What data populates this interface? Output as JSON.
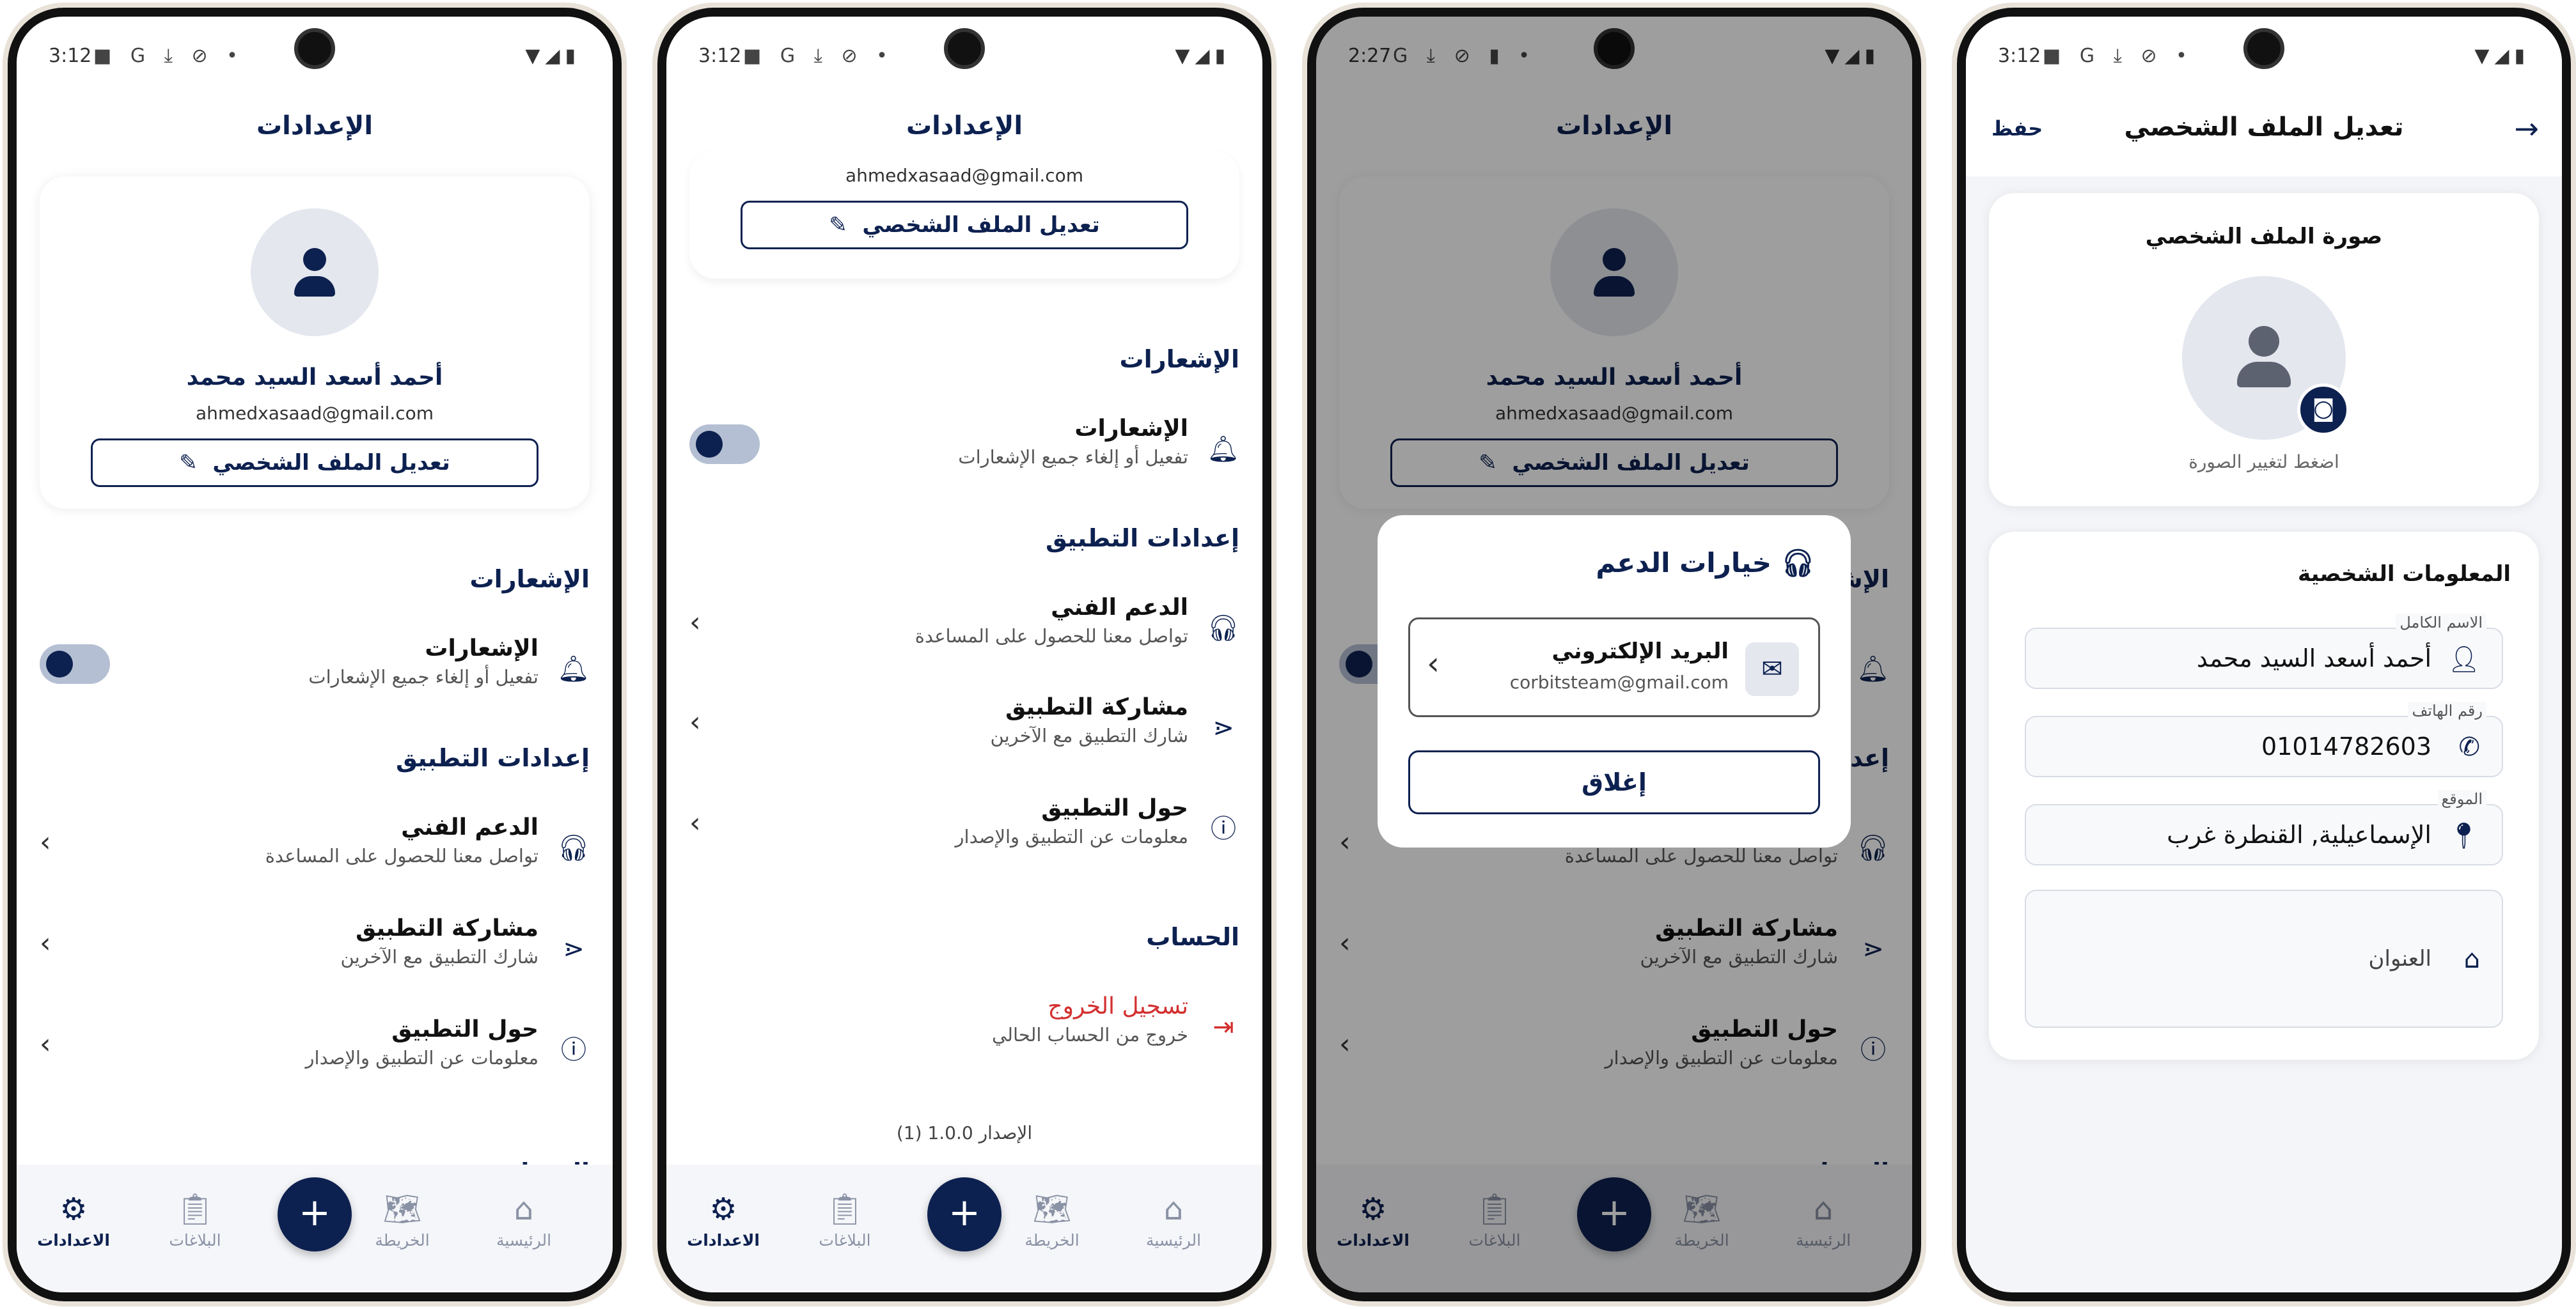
{
  "colors": {
    "primary": "#0d2150",
    "danger": "#d32f2f",
    "muted": "#8a92a5"
  },
  "screen1": {
    "status_time": "3:12",
    "title": "الإعدادات",
    "profile": {
      "name": "أحمد أسعد السيد محمد",
      "email": "ahmedxasaad@gmail.com",
      "edit_label": "تعديل الملف الشخصي"
    },
    "notifications_section": "الإشعارات",
    "notifications": {
      "title": "الإشعارات",
      "subtitle": "تفعيل أو إلغاء جميع الإشعارات",
      "enabled": true
    },
    "app_settings_section": "إعدادات التطبيق",
    "items": [
      {
        "title": "الدعم الفني",
        "subtitle": "تواصل معنا للحصول على المساعدة",
        "icon": "headset-icon"
      },
      {
        "title": "مشاركة التطبيق",
        "subtitle": "شارك التطبيق مع الآخرين",
        "icon": "share-icon"
      },
      {
        "title": "حول التطبيق",
        "subtitle": "معلومات عن التطبيق والإصدار",
        "icon": "info-icon"
      }
    ],
    "account_section_partial": "الحساب"
  },
  "screen2": {
    "status_time": "3:12",
    "title": "الإعدادات",
    "email": "ahmedxasaad@gmail.com",
    "edit_label": "تعديل الملف الشخصي",
    "notifications_section": "الإشعارات",
    "notifications": {
      "title": "الإشعارات",
      "subtitle": "تفعيل أو إلغاء جميع الإشعارات"
    },
    "app_settings_section": "إعدادات التطبيق",
    "items": [
      {
        "title": "الدعم الفني",
        "subtitle": "تواصل معنا للحصول على المساعدة"
      },
      {
        "title": "مشاركة التطبيق",
        "subtitle": "شارك التطبيق مع الآخرين"
      },
      {
        "title": "حول التطبيق",
        "subtitle": "معلومات عن التطبيق والإصدار"
      }
    ],
    "account_section": "الحساب",
    "logout": {
      "title": "تسجيل الخروج",
      "subtitle": "خروج من الحساب الحالي"
    },
    "version": "الإصدار 1.0.0 (1)"
  },
  "screen3": {
    "status_time": "2:27",
    "dialog": {
      "title": "خيارات الدعم",
      "option_title": "البريد الإلكتروني",
      "option_email": "corbitsteam@gmail.com",
      "close_label": "إغلاق"
    }
  },
  "screen4": {
    "status_time": "3:12",
    "title": "تعديل الملف الشخصي",
    "save_label": "حفظ",
    "photo_card_title": "صورة الملف الشخصي",
    "photo_hint": "اضغط لتغيير الصورة",
    "personal_info_title": "المعلومات الشخصية",
    "fields": [
      {
        "label": "الاسم الكامل",
        "value": "أحمد أسعد السيد محمد",
        "icon": "person-icon"
      },
      {
        "label": "رقم الهاتف",
        "value": "01014782603",
        "icon": "phone-icon"
      },
      {
        "label": "الموقع",
        "value": "الإسماعيلية, القنطرة غرب",
        "icon": "location-icon"
      }
    ],
    "address_placeholder": "العنوان"
  },
  "nav": {
    "home": "الرئيسية",
    "map": "الخريطة",
    "reports": "البلاغات",
    "settings": "الاعدادات",
    "add": "+"
  }
}
